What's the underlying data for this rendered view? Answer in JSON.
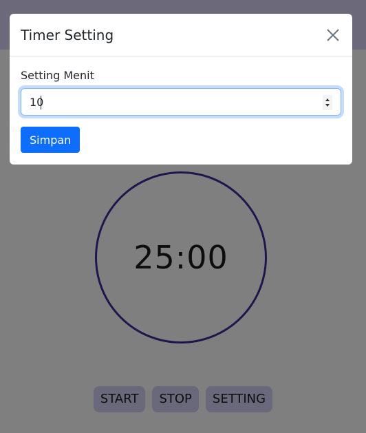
{
  "timer": {
    "display": "25:00"
  },
  "controls": {
    "start_label": "START",
    "stop_label": "STOP",
    "setting_label": "SETTING"
  },
  "modal": {
    "title": "Timer Setting",
    "close_icon": "close-icon",
    "field_label": "Setting Menit",
    "minutes_value": "10",
    "save_label": "Simpan"
  },
  "colors": {
    "accent": "#0d6efd",
    "ring": "#3c2f9a",
    "button_bg": "#d5d0f7",
    "header_bg": "#d9d4f5"
  }
}
